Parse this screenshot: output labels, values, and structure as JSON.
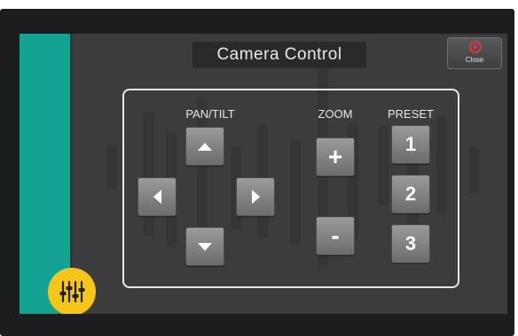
{
  "header": {
    "title": "Camera Control"
  },
  "close_button": {
    "label": "Close"
  },
  "panel": {
    "pan_tilt_label": "PAN/TILT",
    "zoom_label": "ZOOM",
    "preset_label": "PRESET",
    "zoom_in": "+",
    "zoom_out": "-",
    "presets": [
      "1",
      "2",
      "3"
    ]
  },
  "icons": {
    "pan_up": "triangle-up-icon",
    "pan_down": "triangle-down-icon",
    "pan_left": "triangle-left-icon",
    "pan_right": "triangle-right-icon",
    "close": "close-circle-icon",
    "mixer": "audio-mixer-icon"
  },
  "colors": {
    "accent_teal": "#14a393",
    "mixer_yellow": "#f5c518",
    "close_red": "#d63a3a",
    "screen_bg": "#3c3c3e"
  }
}
